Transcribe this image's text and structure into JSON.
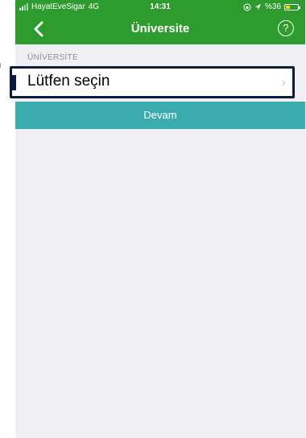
{
  "status_bar": {
    "carrier": "HayatEveSigar",
    "network": "4G",
    "time": "14:31",
    "battery_text": "%36",
    "battery_level": 0.36,
    "icons": [
      "signal-icon",
      "location-icon",
      "battery-icon"
    ],
    "color": "#2e9b2e"
  },
  "nav": {
    "title": "Üniversite",
    "back_icon": "chevron-left-icon",
    "help_icon": "help-circle-icon",
    "help_glyph": "?"
  },
  "form": {
    "section_label": "ÜNİVERSİTE",
    "select_placeholder": "Lütfen seçin",
    "chevron": "›"
  },
  "actions": {
    "continue_label": "Devam",
    "continue_color": "#3aacad"
  }
}
